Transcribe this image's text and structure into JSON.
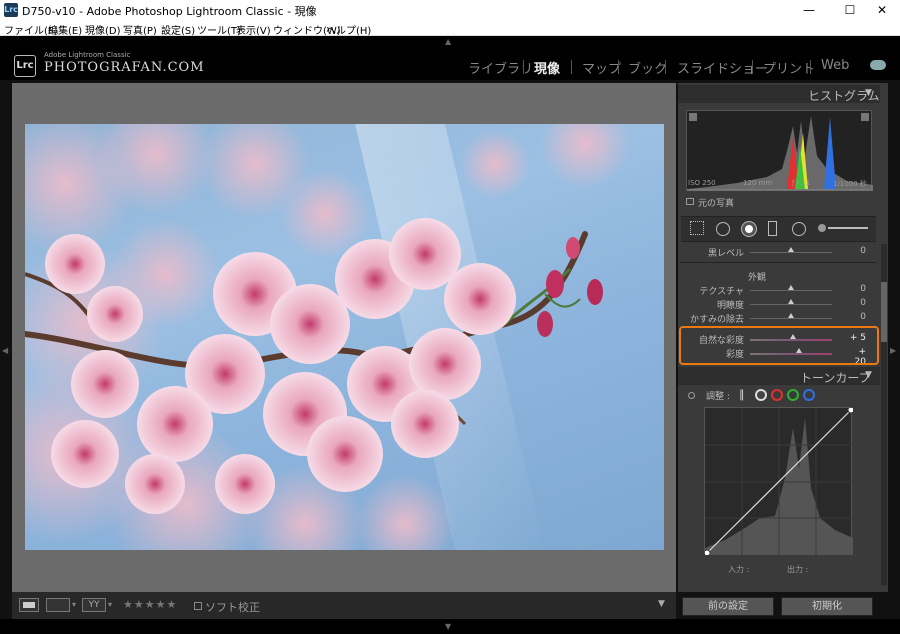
{
  "window": {
    "title": "D750-v10 - Adobe Photoshop Lightroom Classic - 現像",
    "app_icon": "Lrc",
    "controls": {
      "minimize": "—",
      "maximize": "☐",
      "close": "✕"
    }
  },
  "menubar": [
    "ファイル(F)",
    "編集(E)",
    "現像(D)",
    "写真(P)",
    "設定(S)",
    "ツール(T)",
    "表示(V)",
    "ウィンドウ(W)",
    "ヘルプ(H)"
  ],
  "identity": {
    "logo": "Lrc",
    "small": "Adobe Lightroom Classic",
    "big": "PHOTOGRAFAN.COM"
  },
  "modules": [
    "ライブラリ",
    "現像",
    "マップ",
    "ブック",
    "スライドショー",
    "プリント",
    "Web"
  ],
  "active_module": "現像",
  "toolbar": {
    "stars": "★★★★★",
    "soft_proof": "ソフト校正",
    "view_labels": [
      "",
      "YY"
    ]
  },
  "histogram": {
    "title": "ヒストグラム",
    "iso": "ISO 250",
    "focal": "120 mm",
    "aperture": "ƒ / 11",
    "shutter": "1/1000 秒",
    "original_photo": "元の写真"
  },
  "panel": {
    "black_level": {
      "label": "黒レベル",
      "value": "0",
      "pos": 0.5
    },
    "presence_title": "外観",
    "texture": {
      "label": "テクスチャ",
      "value": "0",
      "pos": 0.5
    },
    "clarity": {
      "label": "明瞭度",
      "value": "0",
      "pos": 0.5
    },
    "dehaze": {
      "label": "かすみの除去",
      "value": "0",
      "pos": 0.5
    },
    "vibrance": {
      "label": "自然な彩度",
      "value": "+ 5",
      "pos": 0.52
    },
    "saturation": {
      "label": "彩度",
      "value": "+ 20",
      "pos": 0.6
    }
  },
  "tone_curve": {
    "title": "トーンカーブ",
    "adjust": "調整 :",
    "input": "入力 :",
    "output": "出力 :"
  },
  "buttons": {
    "previous": "前の設定",
    "reset": "初期化"
  },
  "colors": {
    "accent_highlight": "#e87a10",
    "panel_bg": "#3a3a3a"
  }
}
